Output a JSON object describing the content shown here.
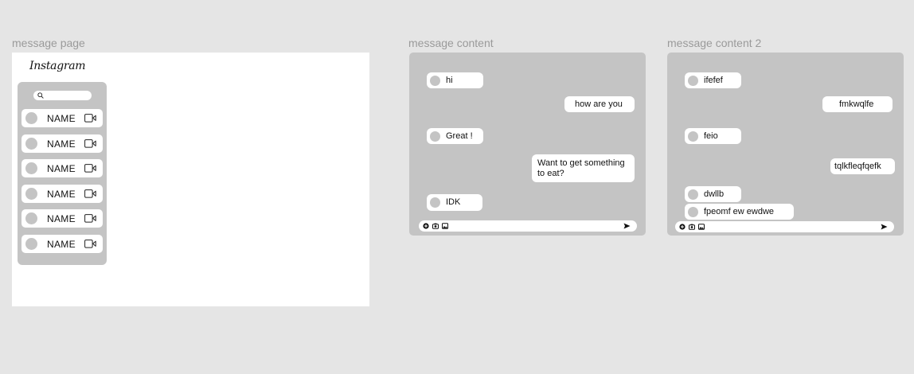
{
  "frames": {
    "page_label": "message page",
    "content_label": "message content",
    "content2_label": "message content 2"
  },
  "app": {
    "logo": "Instagram"
  },
  "search": {
    "icon": "search-icon"
  },
  "contacts": [
    {
      "name": "NAME"
    },
    {
      "name": "NAME"
    },
    {
      "name": "NAME"
    },
    {
      "name": "NAME"
    },
    {
      "name": "NAME"
    },
    {
      "name": "NAME"
    }
  ],
  "chat1": {
    "messages": [
      {
        "direction": "in",
        "text": "hi"
      },
      {
        "direction": "out",
        "text": "how are you"
      },
      {
        "direction": "in",
        "text": "Great !"
      },
      {
        "direction": "out",
        "text": "Want to get something to eat?"
      },
      {
        "direction": "in",
        "text": "IDK"
      }
    ]
  },
  "chat2": {
    "messages": [
      {
        "direction": "in",
        "text": "ifefef"
      },
      {
        "direction": "out",
        "text": "fmkwqlfe"
      },
      {
        "direction": "in",
        "text": "feio"
      },
      {
        "direction": "out",
        "text": "tqlkfleqfqefk"
      },
      {
        "direction": "in",
        "text": "dwllb"
      },
      {
        "direction": "in",
        "text": "fpeomf ew ewdwe"
      }
    ]
  },
  "composer": {
    "icons": [
      "plus-icon",
      "camera-icon",
      "image-icon",
      "send-icon"
    ]
  },
  "colors": {
    "canvas": "#e5e5e5",
    "panel": "#c4c4c4",
    "surface": "#ffffff"
  }
}
